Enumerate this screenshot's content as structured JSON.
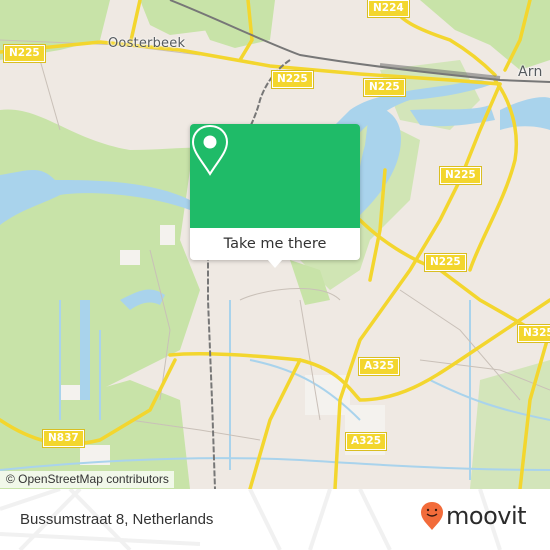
{
  "map": {
    "place_labels": [
      {
        "id": "oosterbeek",
        "text": "Oosterbeek"
      },
      {
        "id": "arnhem",
        "text": "Arn"
      }
    ],
    "road_shields": [
      {
        "id": "n225-west",
        "text": "N225"
      },
      {
        "id": "n224",
        "text": "N224"
      },
      {
        "id": "n225-north-left",
        "text": "N225"
      },
      {
        "id": "n225-north",
        "text": "N225"
      },
      {
        "id": "n225-east",
        "text": "N225"
      },
      {
        "id": "n225-center",
        "text": "N225"
      },
      {
        "id": "n325",
        "text": "N325"
      },
      {
        "id": "a325-north",
        "text": "A325"
      },
      {
        "id": "a325-south",
        "text": "A325"
      },
      {
        "id": "n837",
        "text": "N837"
      }
    ],
    "attribution": "© OpenStreetMap contributors",
    "colors": {
      "land": "#efe9e3",
      "green": "#c8e3a8",
      "water": "#a9d3ec",
      "road": "#f3d62e",
      "rail": "#777777"
    }
  },
  "popup": {
    "button_label": "Take me there",
    "icon": "map-pin-icon",
    "color": "#1fbb68"
  },
  "footer": {
    "address": "Bussumstraat 8, Netherlands",
    "brand": "moovit",
    "brand_color": "#f26b3a"
  }
}
